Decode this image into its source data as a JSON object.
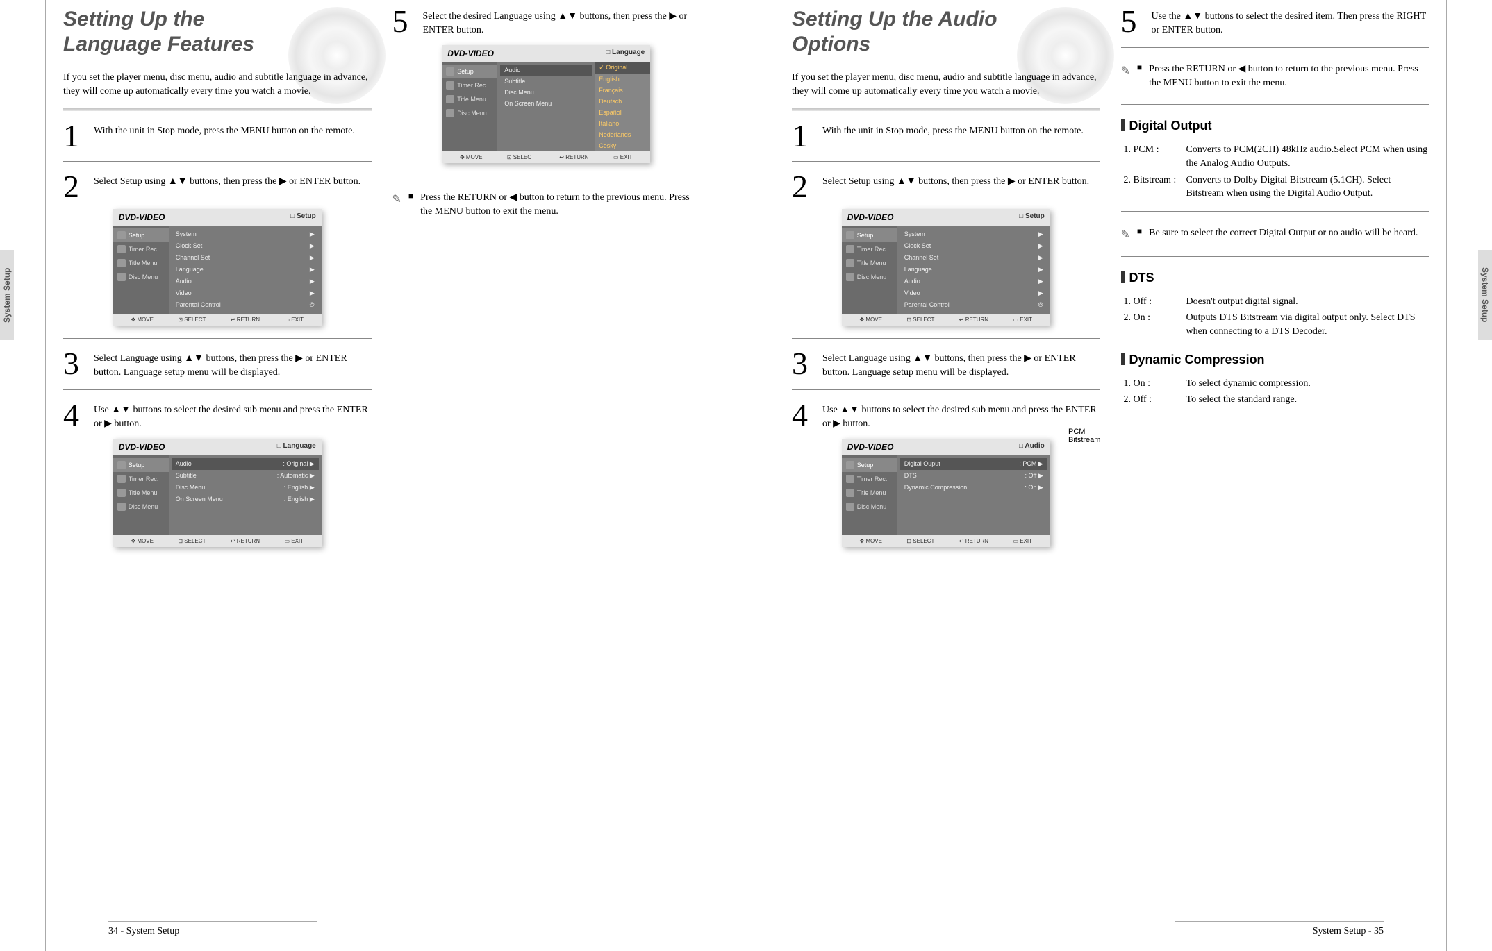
{
  "left": {
    "title1": "Setting Up the",
    "title2": "Language Features",
    "intro": "If you set the player menu, disc menu, audio and subtitle language in advance, they will come up automatically every time you watch a movie.",
    "steps": {
      "s1": "With the unit in Stop mode, press the MENU button on the remote.",
      "s2": "Select Setup using ▲▼ buttons, then press the ▶ or ENTER button.",
      "s3": "Select Language using ▲▼ buttons, then press the ▶ or ENTER button. Language setup menu will be displayed.",
      "s4": "Use ▲▼ buttons to select the desired sub menu and press the ENTER or ▶ button.",
      "s5": "Select the desired Language using ▲▼ buttons, then press the ▶ or ENTER button."
    },
    "note": "Press the RETURN or ◀ button to return to the previous menu. Press the MENU button to exit the menu.",
    "footer": "34 - System Setup",
    "side_tab": "System Setup"
  },
  "right": {
    "title1": "Setting Up the Audio",
    "title2": "Options",
    "intro": "If you set the player menu, disc menu, audio and subtitle language in advance, they will come up automatically every time you watch a movie.",
    "steps": {
      "s1": "With the unit in Stop mode, press the MENU button on the remote.",
      "s2": "Select Setup using ▲▼ buttons, then press the ▶ or ENTER button.",
      "s3": "Select Language using ▲▼ buttons, then press the ▶ or ENTER button. Language setup menu will be displayed.",
      "s4": "Use ▲▼ buttons to select the desired sub menu and press the ENTER or ▶ button.",
      "s5": "Use the ▲▼ buttons to select the desired item. Then press the RIGHT or ENTER button."
    },
    "note1": "Press the RETURN or ◀ button to return to the previous menu. Press the MENU button to exit the menu.",
    "note2": "Be sure to select the correct Digital Output or no audio will be heard.",
    "digital_output": {
      "head": "Digital Output",
      "pcm_label": "1. PCM :",
      "pcm": "Converts to PCM(2CH) 48kHz audio.Select PCM when using the Analog Audio Outputs.",
      "bit_label": "2. Bitstream :",
      "bit": "Converts to Dolby Digital Bitstream (5.1CH). Select Bitstream when using the Digital Audio Output."
    },
    "dts": {
      "head": "DTS",
      "off_label": "1. Off :",
      "off": "Doesn't output digital signal.",
      "on_label": "2. On :",
      "on": "Outputs DTS Bitstream via digital output only. Select DTS when connecting to a DTS Decoder."
    },
    "dynamic": {
      "head": "Dynamic Compression",
      "on_label": "1. On :",
      "on": "To select dynamic compression.",
      "off_label": "2. Off :",
      "off": "To select the standard range."
    },
    "callout": "PCM\nBitstream",
    "footer": "System Setup - 35",
    "side_tab": "System Setup"
  },
  "osd": {
    "header": "DVD-VIDEO",
    "corner_setup": "□ Setup",
    "corner_lang": "□ Language",
    "corner_audio": "□ Audio",
    "sidebar": [
      "Setup",
      "Timer Rec.",
      "Title Menu",
      "Disc Menu"
    ],
    "setup_menu": [
      "System",
      "Clock Set",
      "Channel Set",
      "Language",
      "Audio",
      "Video",
      "Parental Control"
    ],
    "lang_menu": [
      {
        "k": "Audio",
        "v": ": Original"
      },
      {
        "k": "Subtitle",
        "v": ": Automatic"
      },
      {
        "k": "Disc Menu",
        "v": ": English"
      },
      {
        "k": "On Screen Menu",
        "v": ": English"
      }
    ],
    "lang_popup_menu": [
      "Audio",
      "Subtitle",
      "Disc Menu",
      "On Screen Menu"
    ],
    "lang_popup": [
      "Original",
      "English",
      "Français",
      "Deutsch",
      "Español",
      "Italiano",
      "Nederlands",
      "Cesky"
    ],
    "audio_menu": [
      {
        "k": "Digital Ouput",
        "v": ": PCM"
      },
      {
        "k": "DTS",
        "v": ": Off"
      },
      {
        "k": "Dynamic Compression",
        "v": ": On"
      }
    ],
    "footer": {
      "move": "MOVE",
      "select": "SELECT",
      "return": "RETURN",
      "exit": "EXIT"
    }
  }
}
